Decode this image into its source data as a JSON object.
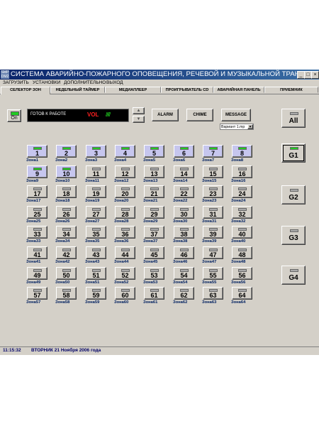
{
  "window": {
    "logo_text": "SMP\nDM2",
    "title": "СИСТЕМА АВАРИЙНО-ПОЖАРНОГО ОПОВЕЩЕНИЯ, РЕЧЕВОЙ И МУЗЫКАЛЬНОЙ ТРАНСЛЯЦИИ",
    "minimize": "_",
    "maximize": "□",
    "close": "×"
  },
  "menu": [
    "ЗАГРУЗИТЬ",
    "УСТАНОВКИ",
    "ДОПОЛНИТЕЛЬНО",
    "ВЫХОД"
  ],
  "tabs": [
    {
      "label": "СЕЛЕКТОР ЗОН",
      "active": true
    },
    {
      "label": "НЕДЕЛЬНЫЙ ТАЙМЕР",
      "active": false
    },
    {
      "label": "МЕДИАПЛЕЕР",
      "active": false
    },
    {
      "label": "ПРОИГРЫВАТЕЛЬ CD",
      "active": false
    },
    {
      "label": "АВАРИЙНАЯ ПАНЕЛЬ",
      "active": false
    },
    {
      "label": "ПРИЕМНИК",
      "active": false
    }
  ],
  "controls": {
    "on_label": "On",
    "status_text": "ГОТОВ К РАБОТЕ",
    "vol_label": "VOL",
    "vol_bars": "/////",
    "up_arrow": "▲",
    "down_arrow": "▼",
    "alarm": "ALARM",
    "chime": "CHIME",
    "message": "MESSAGE",
    "variant": "Вариант 1.mp",
    "variant_dd": "▼"
  },
  "zone_label_prefix": "Зона",
  "zones_active": [
    1,
    2,
    3,
    4,
    5,
    6,
    7,
    8,
    9,
    10
  ],
  "groups": [
    {
      "label": "All",
      "selected": false
    },
    {
      "label": "G1",
      "selected": true
    },
    {
      "label": "G2",
      "selected": false
    },
    {
      "label": "G3",
      "selected": false
    },
    {
      "label": "G4",
      "selected": false
    }
  ],
  "statusbar": {
    "time": "11:15:32",
    "date": "ВТОРНИК 21 Ноября 2006 года"
  },
  "colors": {
    "led_on": "#22cc22",
    "zone_active_bg": "#c6c6ee",
    "title_bar": "#0a246a",
    "vol_red": "#ff2020"
  }
}
